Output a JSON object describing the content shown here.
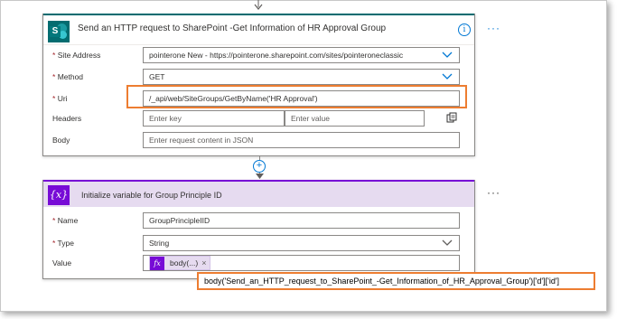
{
  "http_action": {
    "title": "Send an HTTP request to SharePoint -Get Information of HR Approval Group",
    "info_glyph": "i",
    "more_glyph": "···",
    "site_address": {
      "label": "Site Address",
      "value": "pointerone New - https://pointerone.sharepoint.com/sites/pointeroneclassic"
    },
    "method": {
      "label": "Method",
      "value": "GET"
    },
    "uri": {
      "label": "Uri",
      "value": "/_api/web/SiteGroups/GetByName('HR Approval')"
    },
    "headers": {
      "label": "Headers",
      "key_placeholder": "Enter key",
      "value_placeholder": "Enter value"
    },
    "body": {
      "label": "Body",
      "placeholder": "Enter request content in JSON"
    },
    "required_mark": "*"
  },
  "connector": {
    "plus_glyph": "+"
  },
  "init_variable": {
    "icon_text": "{x}",
    "title": "Initialize variable for Group Principle ID",
    "more_glyph": "···",
    "name": {
      "label": "Name",
      "value": "GroupPrincipleIID"
    },
    "type": {
      "label": "Type",
      "value": "String"
    },
    "value": {
      "label": "Value",
      "token_icon": "fx",
      "token_text": "body(...)",
      "token_remove": "×"
    },
    "expression": "body('Send_an_HTTP_request_to_SharePoint_-Get_Information_of_HR_Approval_Group')['d']['id']"
  },
  "colors": {
    "sharepoint_teal": "#036c70",
    "variable_purple": "#770bd6",
    "variable_header_bg": "#e6dbf0",
    "highlight_orange": "#ed7d31",
    "link_blue": "#0078d4"
  },
  "icons": {
    "sharepoint": "sharepoint-icon",
    "info": "info-icon",
    "chevron": "chevron-down-icon",
    "copy": "copy-icon",
    "variable": "variable-icon",
    "function": "function-icon"
  }
}
